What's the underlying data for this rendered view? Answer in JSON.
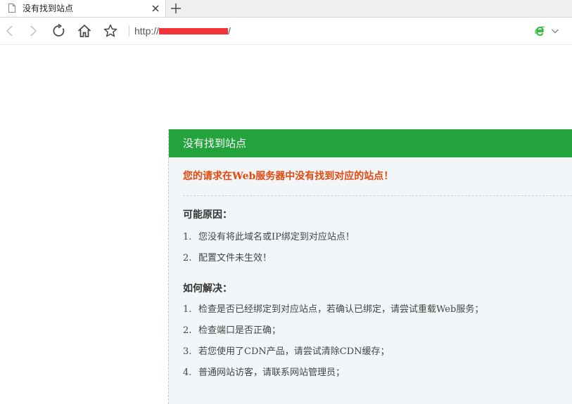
{
  "tab": {
    "title": "没有找到站点",
    "icon": "page-icon",
    "close_icon": "close-icon",
    "new_tab_icon": "plus-icon"
  },
  "toolbar": {
    "back_icon": "chevron-left-icon",
    "forward_icon": "chevron-right-icon",
    "refresh_icon": "refresh-icon",
    "home_icon": "home-icon",
    "favorite_icon": "star-icon",
    "url_prefix": "http://",
    "url_suffix": "/",
    "engine_icon": "ie-icon",
    "engine_dropdown_icon": "chevron-down-icon"
  },
  "panel": {
    "title": "没有找到站点",
    "warning": "您的请求在Web服务器中没有找到对应的站点！",
    "causes": {
      "title": "可能原因：",
      "items": [
        {
          "num": "1.",
          "text": "您没有将此域名或IP绑定到对应站点！"
        },
        {
          "num": "2.",
          "text": "配置文件未生效！"
        }
      ]
    },
    "solutions": {
      "title": "如何解决：",
      "items": [
        {
          "num": "1.",
          "text": "检查是否已经绑定到对应站点，若确认已绑定，请尝试重载Web服务；"
        },
        {
          "num": "2.",
          "text": "检查端口是否正确；"
        },
        {
          "num": "3.",
          "text": "若您使用了CDN产品，请尝试清除CDN缓存；"
        },
        {
          "num": "4.",
          "text": "普通网站访客，请联系网站管理员；"
        }
      ]
    }
  },
  "colors": {
    "header_green": "#22a33c",
    "warning_orange": "#e5480c",
    "redaction_red": "#f0343a",
    "panel_bg": "#f3f6f8"
  }
}
